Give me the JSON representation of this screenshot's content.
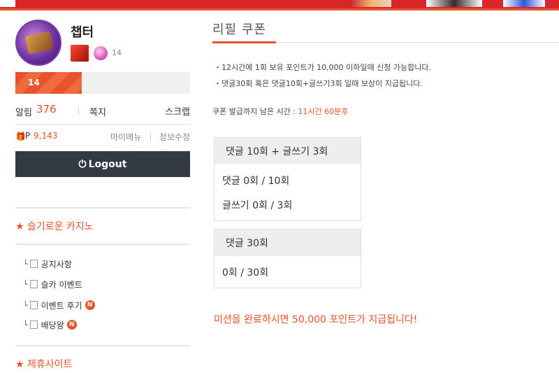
{
  "profile": {
    "username": "챕터",
    "level_small": "14",
    "level_bar_label": "14",
    "level_progress_percent": 38,
    "alerts_label": "알림",
    "alerts_count": "376",
    "memo_label": "쪽지",
    "scrap_label": "스크랩",
    "gift_icon": "🎁",
    "points_prefix": "P",
    "points_value": "9,143",
    "my_menu_label": "마이메뉴",
    "edit_info_label": "정보수정",
    "logout_label": "Logout",
    "logout_icon": "⏻"
  },
  "sidebar": {
    "category_title": "★ 슬기로운 카지노",
    "items": [
      {
        "label": "공지사항",
        "new": false
      },
      {
        "label": "슬카 이벤트",
        "new": false
      },
      {
        "label": "이벤트 후기",
        "new": true
      },
      {
        "label": "배당왕",
        "new": true
      }
    ],
    "new_badge": "N",
    "branch_glyph": "└",
    "partner_title": "★ 제휴사이트"
  },
  "main": {
    "title": "리필 쿠폰",
    "info_lines": [
      "・12시간에 1회 보유 포인트가 10,000 이하일때 신청 가능합니다.",
      "・댓글30회 혹은 댓글10회+글쓰기3회 일때 보상이 지급됩니다."
    ],
    "countdown_label": "쿠폰 발급까지 남은 시간 : ",
    "countdown_value": "11시간 60분후",
    "box1": {
      "header": "댓글 10회 + 글쓰기 3회",
      "lines": [
        "댓글 0회 / 10회",
        "글쓰기 0회 / 3회"
      ]
    },
    "box2": {
      "header": "댓글 30회",
      "lines": [
        "0회 / 30회"
      ]
    },
    "mission_text": "미션을 완료하시면 50,000 포인트가 지급됩니다!"
  }
}
